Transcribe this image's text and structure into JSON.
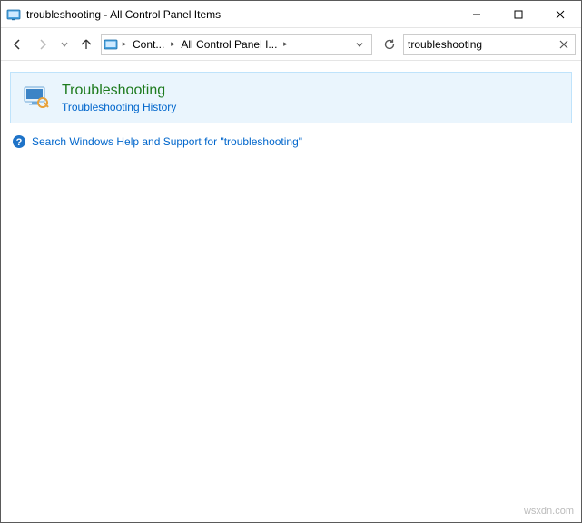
{
  "titlebar": {
    "title": "troubleshooting - All Control Panel Items"
  },
  "address": {
    "crumb1": "Cont...",
    "crumb2": "All Control Panel I..."
  },
  "search": {
    "value": "troubleshooting"
  },
  "result": {
    "title": "Troubleshooting",
    "subtitle": "Troubleshooting History"
  },
  "help": {
    "text": "Search Windows Help and Support for \"troubleshooting\""
  },
  "watermark": "wsxdn.com"
}
